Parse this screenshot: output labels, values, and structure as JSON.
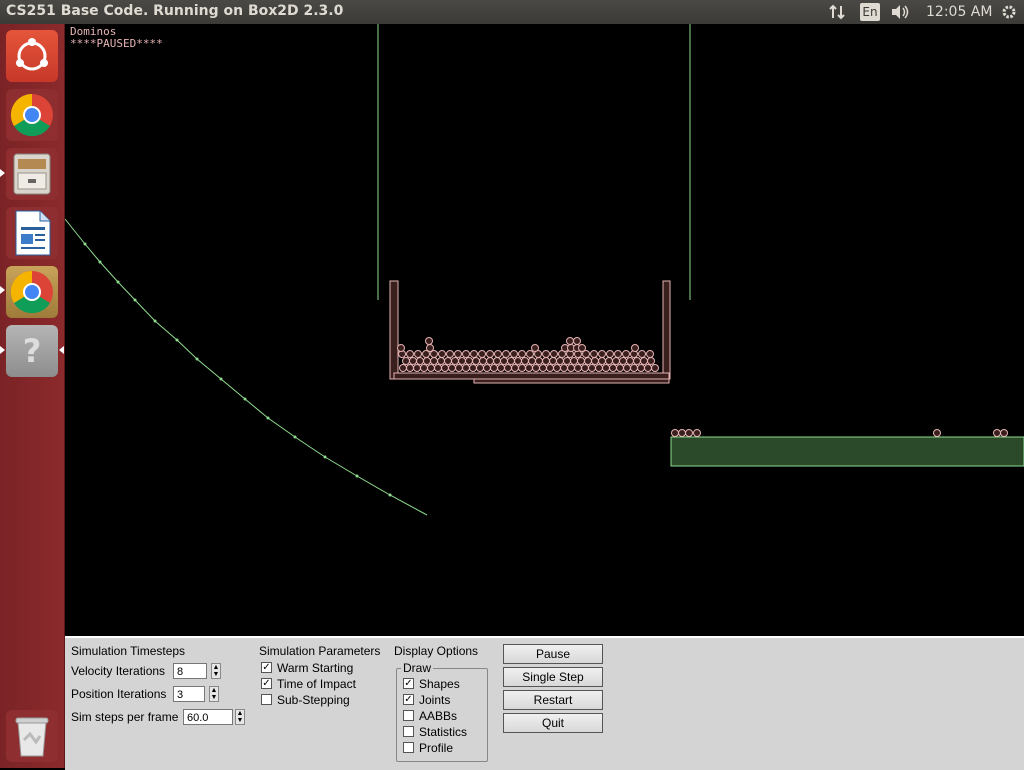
{
  "window": {
    "title": "CS251 Base Code. Running on Box2D 2.3.0"
  },
  "tray": {
    "network_icon": "network-updown-icon",
    "language": "En",
    "volume_icon": "volume-icon",
    "time": "12:05 AM",
    "settings_icon": "gear-icon"
  },
  "launcher": {
    "items": [
      {
        "name": "ubuntu-dash-icon"
      },
      {
        "name": "chrome-icon"
      },
      {
        "name": "file-cabinet-icon"
      },
      {
        "name": "libreoffice-writer-icon"
      },
      {
        "name": "chrome-active-icon"
      },
      {
        "name": "help-icon"
      },
      {
        "name": "trash-icon"
      }
    ]
  },
  "sim": {
    "line1": "Dominos",
    "line2": "****PAUSED****"
  },
  "panel": {
    "timesteps": {
      "heading": "Simulation Timesteps",
      "velocity_label": "Velocity Iterations",
      "velocity_value": "8",
      "position_label": "Position Iterations",
      "position_value": "3",
      "steps_label": "Sim steps per frame",
      "steps_value": "60.0"
    },
    "params": {
      "heading": "Simulation Parameters",
      "warm": "Warm Starting",
      "warm_checked": true,
      "toi": "Time of Impact",
      "toi_checked": true,
      "substep": "Sub-Stepping",
      "substep_checked": false
    },
    "display": {
      "heading": "Display Options",
      "draw": "Draw",
      "shapes": "Shapes",
      "shapes_checked": true,
      "joints": "Joints",
      "joints_checked": true,
      "aabbs": "AABBs",
      "aabbs_checked": false,
      "statistics": "Statistics",
      "statistics_checked": false,
      "profile": "Profile",
      "profile_checked": false
    },
    "buttons": {
      "pause": "Pause",
      "single_step": "Single Step",
      "restart": "Restart",
      "quit": "Quit"
    }
  }
}
